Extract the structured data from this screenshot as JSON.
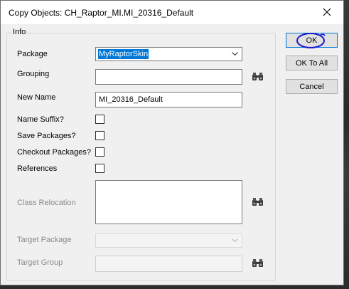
{
  "window": {
    "title": "Copy Objects: CH_Raptor_MI.MI_20316_Default"
  },
  "group": {
    "label": "Info"
  },
  "fields": {
    "package_label": "Package",
    "package_value": "MyRaptorSkin",
    "grouping_label": "Grouping",
    "grouping_value": "",
    "new_name_label": "New Name",
    "new_name_value": "MI_20316_Default",
    "name_suffix_label": "Name Suffix?",
    "save_packages_label": "Save Packages?",
    "checkout_packages_label": "Checkout Packages?",
    "references_label": "References",
    "class_relocation_label": "Class Relocation",
    "target_package_label": "Target Package",
    "target_group_label": "Target Group"
  },
  "checkboxes": {
    "name_suffix_checked": false,
    "save_packages_checked": false,
    "checkout_packages_checked": false,
    "references_checked": false
  },
  "buttons": {
    "ok": "OK",
    "ok_to_all": "OK To All",
    "cancel": "Cancel"
  },
  "icons": {
    "close": "close-icon",
    "browse": "binoculars-icon",
    "dropdown": "chevron-down-icon"
  },
  "colors": {
    "selection": "#0078d7",
    "annotation": "#1a1acc"
  }
}
